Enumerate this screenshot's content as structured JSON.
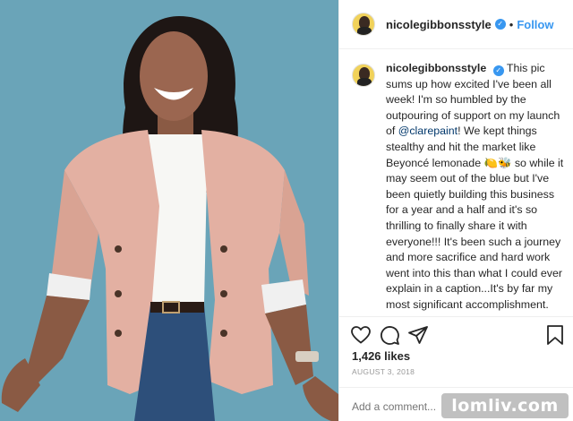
{
  "post": {
    "username": "nicolegibbonsstyle",
    "verified_mark": "✓",
    "separator": "•",
    "follow_label": "Follow"
  },
  "caption": {
    "username": "nicolegibbonsstyle",
    "text_1": "This pic sums up how excited I've been all week! I'm so humbled by the outpouring of support on my launch of ",
    "mention": "@clarepaint",
    "text_2": "! We kept things stealthy and hit the market like Beyoncé lemonade 🍋🐝 so while it may seem out of the blue but I've been quietly building this business for a year and a half and it's so thrilling to finally share it with everyone!!! It's been such a journey and more sacrifice and hard work went into this than what I could ever explain in a caption...It's by far my most significant accomplishment. I've been seriously emotional over here reading all of your comments and well-wishes and am doing my best to reply back to everyone! And"
  },
  "actions": {
    "icons": [
      "heart-icon",
      "comment-icon",
      "share-icon",
      "bookmark-icon"
    ],
    "likes": "1,426 likes",
    "date": "AUGUST 3, 2018"
  },
  "comment": {
    "placeholder": "Add a comment..."
  },
  "watermark": "lomliv.com",
  "colors": {
    "accent": "#3897f0",
    "photo_background": "#6aa4b8",
    "blazer": "#e3b0a2"
  }
}
